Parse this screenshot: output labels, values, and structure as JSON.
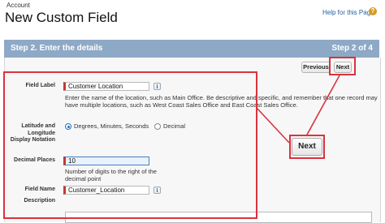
{
  "header": {
    "breadcrumb": "Account",
    "title": "New Custom Field",
    "help_link": "Help for this Page",
    "help_icon": "?"
  },
  "step_bar": {
    "title": "Step 2. Enter the details",
    "count": "Step 2 of 4"
  },
  "buttons": {
    "previous": "Previous",
    "next": "Next",
    "next_callout": "Next"
  },
  "form": {
    "field_label": {
      "label": "Field Label",
      "value": "Customer Location",
      "help": "Enter the name of the location, such as Main Office. Be descriptive and specific, and remember that one record may",
      "help_line2": "have multiple locations, such as West Coast Sales Office and East Coast Sales Office."
    },
    "notation": {
      "label_line1": "Latitude and",
      "label_line2": "Longitude",
      "label_line3": "Display Notation",
      "option_dms": "Degrees, Minutes, Seconds",
      "option_decimal": "Decimal",
      "selected": "Degrees, Minutes, Seconds"
    },
    "decimal_places": {
      "label": "Decimal Places",
      "value": "10",
      "help_line1": "Number of digits to the right of the",
      "help_line2": "decimal point"
    },
    "field_name": {
      "label": "Field Name",
      "value": "Customer_Location"
    },
    "description": {
      "label": "Description",
      "value": ""
    }
  },
  "colors": {
    "step_bar": "#8ea9c6",
    "highlight_red": "#d9333f",
    "link_blue": "#1f5e9e"
  }
}
